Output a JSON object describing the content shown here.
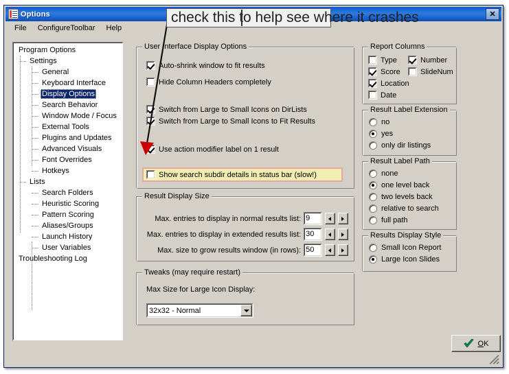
{
  "window": {
    "title": "Options",
    "icon": "options-window-icon",
    "close_label": "✕"
  },
  "menubar": {
    "items": [
      {
        "label": "File"
      },
      {
        "label": "ConfigureToolbar"
      },
      {
        "label": "Help"
      }
    ]
  },
  "annotation": {
    "text": "check this to help see where it crashes",
    "arrow_color": "#cc0000"
  },
  "tree": {
    "items": [
      {
        "label": "Program Options",
        "level": 0,
        "selected": false
      },
      {
        "label": "Settings",
        "level": 1,
        "selected": false
      },
      {
        "label": "General",
        "level": 2,
        "selected": false
      },
      {
        "label": "Keyboard Interface",
        "level": 2,
        "selected": false
      },
      {
        "label": "Display Options",
        "level": 2,
        "selected": true
      },
      {
        "label": "Search Behavior",
        "level": 2,
        "selected": false
      },
      {
        "label": "Window Mode / Focus",
        "level": 2,
        "selected": false
      },
      {
        "label": "External Tools",
        "level": 2,
        "selected": false
      },
      {
        "label": "Plugins and Updates",
        "level": 2,
        "selected": false
      },
      {
        "label": "Advanced Visuals",
        "level": 2,
        "selected": false
      },
      {
        "label": "Font Overrides",
        "level": 2,
        "selected": false
      },
      {
        "label": "Hotkeys",
        "level": 2,
        "selected": false
      },
      {
        "label": "Lists",
        "level": 1,
        "selected": false
      },
      {
        "label": "Search Folders",
        "level": 2,
        "selected": false
      },
      {
        "label": "Heuristic Scoring",
        "level": 2,
        "selected": false
      },
      {
        "label": "Pattern Scoring",
        "level": 2,
        "selected": false
      },
      {
        "label": "Aliases/Groups",
        "level": 2,
        "selected": false
      },
      {
        "label": "Launch History",
        "level": 2,
        "selected": false
      },
      {
        "label": "User Variables",
        "level": 2,
        "selected": false
      },
      {
        "label": "Troubleshooting Log",
        "level": 0,
        "selected": false
      }
    ]
  },
  "ui_display_options": {
    "title": "User Interface Display Options",
    "checkboxes": [
      {
        "label": "Auto-shrink window to fit results",
        "checked": true
      },
      {
        "label": "Hide Column Headers completely",
        "checked": false
      },
      {
        "label": "Switch from Large to Small Icons on DirLists",
        "checked": true
      },
      {
        "label": "Switch from Large to Small Icons to Fit Results",
        "checked": true
      },
      {
        "label": "Use action modifier label on 1 result",
        "checked": true
      },
      {
        "label": "Show search subdir details in status bar (slow!)",
        "checked": false,
        "highlighted": true
      }
    ],
    "highlight_fill": "#f2eeb3",
    "highlight_border": "#e3a8a0"
  },
  "result_display_size": {
    "title": "Result Display Size",
    "rows": [
      {
        "label": "Max. entries to display in normal results list:",
        "value": "9"
      },
      {
        "label": "Max. entries to display in extended results list:",
        "value": "30"
      },
      {
        "label": "Max. size to grow results window (in rows):",
        "value": "50"
      }
    ]
  },
  "tweaks": {
    "title": "Tweaks (may require restart)",
    "combo_label": "Max Size for Large Icon Display:",
    "combo_value": "32x32 - Normal"
  },
  "report_columns": {
    "title": "Report Columns",
    "items": [
      {
        "label": "Type",
        "checked": false
      },
      {
        "label": "Number",
        "checked": true
      },
      {
        "label": "Score",
        "checked": true
      },
      {
        "label": "SlideNum",
        "checked": false
      },
      {
        "label": "Location",
        "checked": true
      },
      {
        "label": "Date",
        "checked": false
      }
    ]
  },
  "result_label_extension": {
    "title": "Result Label Extension",
    "options": [
      {
        "label": "no",
        "selected": false
      },
      {
        "label": "yes",
        "selected": true
      },
      {
        "label": "only dir listings",
        "selected": false
      }
    ]
  },
  "result_label_path": {
    "title": "Result Label Path",
    "options": [
      {
        "label": "none",
        "selected": false
      },
      {
        "label": "one level back",
        "selected": true
      },
      {
        "label": "two levels back",
        "selected": false
      },
      {
        "label": "relative to search",
        "selected": false
      },
      {
        "label": "full path",
        "selected": false
      }
    ]
  },
  "results_display_style": {
    "title": "Results Display Style",
    "options": [
      {
        "label": "Small Icon Report",
        "selected": false
      },
      {
        "label": "Large Icon Slides",
        "selected": true
      }
    ]
  },
  "footer": {
    "ok_prefix": "O",
    "ok_suffix": "K",
    "ok_check_color": "#00a000"
  }
}
